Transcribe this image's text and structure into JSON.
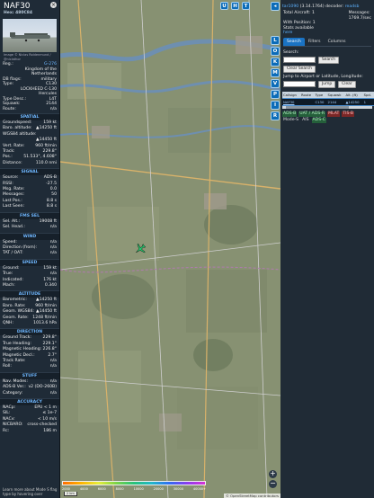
{
  "aircraft": {
    "callsign": "NAF30",
    "hex_label": "Hex:",
    "hex": "480C84",
    "photo_credit": "Image © Niclas Roldenmund / @niclathor",
    "reg_label": "Reg.:",
    "reg_value": "G-276",
    "country": "Kingdom of the Netherlands",
    "db_flags_label": "DB flags:",
    "db_flags": "military",
    "type_label": "Type:",
    "type": "C130",
    "type_desc": "LOCKHEED C-130 Hercules",
    "type_desc_label": "Type Desc.:",
    "type_desc_value": "L4T",
    "squawk_label": "Squawk:",
    "squawk": "2144",
    "route_label": "Route:",
    "route": "n/a"
  },
  "sections": {
    "spatial": "SPATIAL",
    "signal": "SIGNAL",
    "fms": "FMS SEL",
    "wind": "WIND",
    "speed": "SPEED",
    "altitude": "ALTITUDE",
    "direction": "DIRECTION",
    "stuff": "STUFF",
    "accuracy": "ACCURACY"
  },
  "spatial": [
    {
      "k": "Groundspeed:",
      "v": "159 kt"
    },
    {
      "k": "Baro. altitude:",
      "v": "▲14250 ft"
    },
    {
      "k": "WGS84 altitude:",
      "v": ""
    },
    {
      "k": "",
      "v": "▲14450 ft"
    },
    {
      "k": "Vert. Rate:",
      "v": "960 ft/min"
    },
    {
      "k": "Track:",
      "v": "229.8°"
    },
    {
      "k": "Pos.:",
      "v": "51.533°, 4.608°"
    },
    {
      "k": "Distance:",
      "v": "110.0 nmi"
    }
  ],
  "signal": [
    {
      "k": "Source:",
      "v": "ADS-B"
    },
    {
      "k": "RSSI:",
      "v": "-27.5"
    },
    {
      "k": "Msg. Rate:",
      "v": "0.0"
    },
    {
      "k": "Messages:",
      "v": "50"
    },
    {
      "k": "Last Pos.:",
      "v": "8.8 s"
    },
    {
      "k": "Last Seen:",
      "v": "8.8 s"
    }
  ],
  "fms": [
    {
      "k": "Sel. Alt.:",
      "v": "19008 ft"
    },
    {
      "k": "Sel. Head.:",
      "v": "n/a"
    }
  ],
  "wind": [
    {
      "k": "Speed:",
      "v": "n/a"
    },
    {
      "k": "Direction (from):",
      "v": "n/a"
    },
    {
      "k": "TAT / OAT:",
      "v": "n/a"
    }
  ],
  "speed": [
    {
      "k": "Ground:",
      "v": "159 kt"
    },
    {
      "k": "True:",
      "v": "n/a"
    },
    {
      "k": "Indicated:",
      "v": "176 kt"
    },
    {
      "k": "Mach:",
      "v": "0.340"
    }
  ],
  "altitude": [
    {
      "k": "Barometric:",
      "v": "▲14250 ft"
    },
    {
      "k": "Baro. Rate:",
      "v": "960 ft/min"
    },
    {
      "k": "Geom. WGS84:",
      "v": "▲14450 ft"
    },
    {
      "k": "Geom. Rate:",
      "v": "1248 ft/min"
    },
    {
      "k": "QNH:",
      "v": "1013.6 hPa"
    }
  ],
  "direction": [
    {
      "k": "Ground Track:",
      "v": "229.8°"
    },
    {
      "k": "True Heading:",
      "v": "229.1°"
    },
    {
      "k": "Magnetic Heading:",
      "v": "226.8°"
    },
    {
      "k": "Magnetic Decl.:",
      "v": "2.7°"
    },
    {
      "k": "Track Rate:",
      "v": "n/a"
    },
    {
      "k": "Roll:",
      "v": "n/a"
    }
  ],
  "stuff": [
    {
      "k": "Nav. Modes:",
      "v": "n/a"
    },
    {
      "k": "ADS-B Ver.:",
      "v": "v2 (DO-260B)"
    },
    {
      "k": "Category:",
      "v": "n/a"
    }
  ],
  "accuracy": [
    {
      "k": "NACp:",
      "v": "EPU < 1 m"
    },
    {
      "k": "SIL:",
      "v": "≤ 1e-7"
    },
    {
      "k": "NACv:",
      "v": "< 10 m/s"
    },
    {
      "k": "NICBARO:",
      "v": "cross-checked"
    },
    {
      "k": "Rc:",
      "v": "186 m"
    }
  ],
  "footer_text": "Learn more about Mode S flag type by hovering over",
  "map": {
    "buttons_top": [
      "U",
      "H",
      "T"
    ],
    "scale": "2 km",
    "attribution": "© OpenStreetMap contributors",
    "zoom_in": "+",
    "zoom_out": "−",
    "altitude_labels": [
      "2000",
      "4000",
      "6000",
      "8000",
      "10000",
      "20000",
      "30000",
      "40000+"
    ],
    "aircraft_color": "#28c76f"
  },
  "strip_buttons": [
    "◂",
    "L",
    "O",
    "K",
    "M",
    "V",
    "P",
    "I",
    "R"
  ],
  "sidebar": {
    "app_link": "tar1090",
    "version": "(3.14.1764)",
    "decoder_label": "decoder:",
    "decoder": "readsb",
    "total_aircraft_label": "Total Aircraft:",
    "total_aircraft": "1",
    "messages_label": "Messages:",
    "messages": "1769.7/sec",
    "with_position_label": "With Position:",
    "with_position": "1",
    "stats_label": "Stats available",
    "stats_link": "here",
    "tabs": [
      "Search",
      "Filters",
      "Columns"
    ],
    "search_label": "Search:",
    "search_button": "Search",
    "clear_search_button": "Clear Search",
    "jump_label": "Jump to Airport or Latitude, Longitude:",
    "jump_button": "Jump",
    "clear_button": "Clear",
    "columns": [
      "Callsign",
      "Route",
      "Type",
      "Squawk",
      "Alt. (ft)",
      "Spd."
    ],
    "rows": [
      {
        "callsign": "NAF30",
        "route": "",
        "type": "C130",
        "squawk": "2144",
        "alt": "▲14250",
        "spd": "1"
      }
    ],
    "legend_tags": [
      {
        "label": "ADS-B",
        "cls": "g"
      },
      {
        "label": "UAT / ADS-R",
        "cls": "g"
      },
      {
        "label": "MLAT",
        "cls": "r"
      },
      {
        "label": "TIS-B",
        "cls": "r"
      },
      {
        "label": "Mode-S",
        "cls": "p"
      },
      {
        "label": "AIS",
        "cls": "p"
      },
      {
        "label": "ADS-C",
        "cls": "g"
      }
    ]
  }
}
